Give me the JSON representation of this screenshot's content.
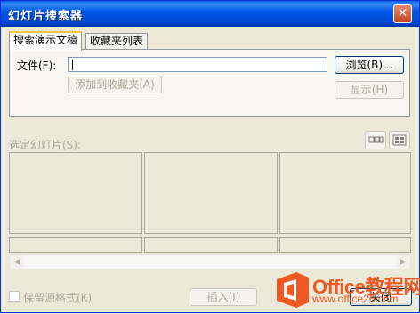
{
  "window": {
    "title": "幻灯片搜索器",
    "close_glyph": "✕"
  },
  "tabs": [
    {
      "label": "搜索演示文稿",
      "active": true
    },
    {
      "label": "收藏夹列表",
      "active": false
    }
  ],
  "search": {
    "file_label": "文件(F):",
    "file_value": "",
    "browse_label": "浏览(B)...",
    "add_favorites_label": "添加到收藏夹(A)",
    "show_label": "显示(H)"
  },
  "slides": {
    "label": "选定幻灯片(S):",
    "view_icons": [
      "slides-strip-view-icon",
      "slides-grid-view-icon"
    ]
  },
  "footer": {
    "keep_format_label": "保留源格式(K)",
    "keep_format_checked": false,
    "insert_label": "插入(I)",
    "close_label": "关闭"
  },
  "watermark": {
    "brand": "Office教程网",
    "url": "www.office26.com",
    "color": "#F05A22"
  }
}
